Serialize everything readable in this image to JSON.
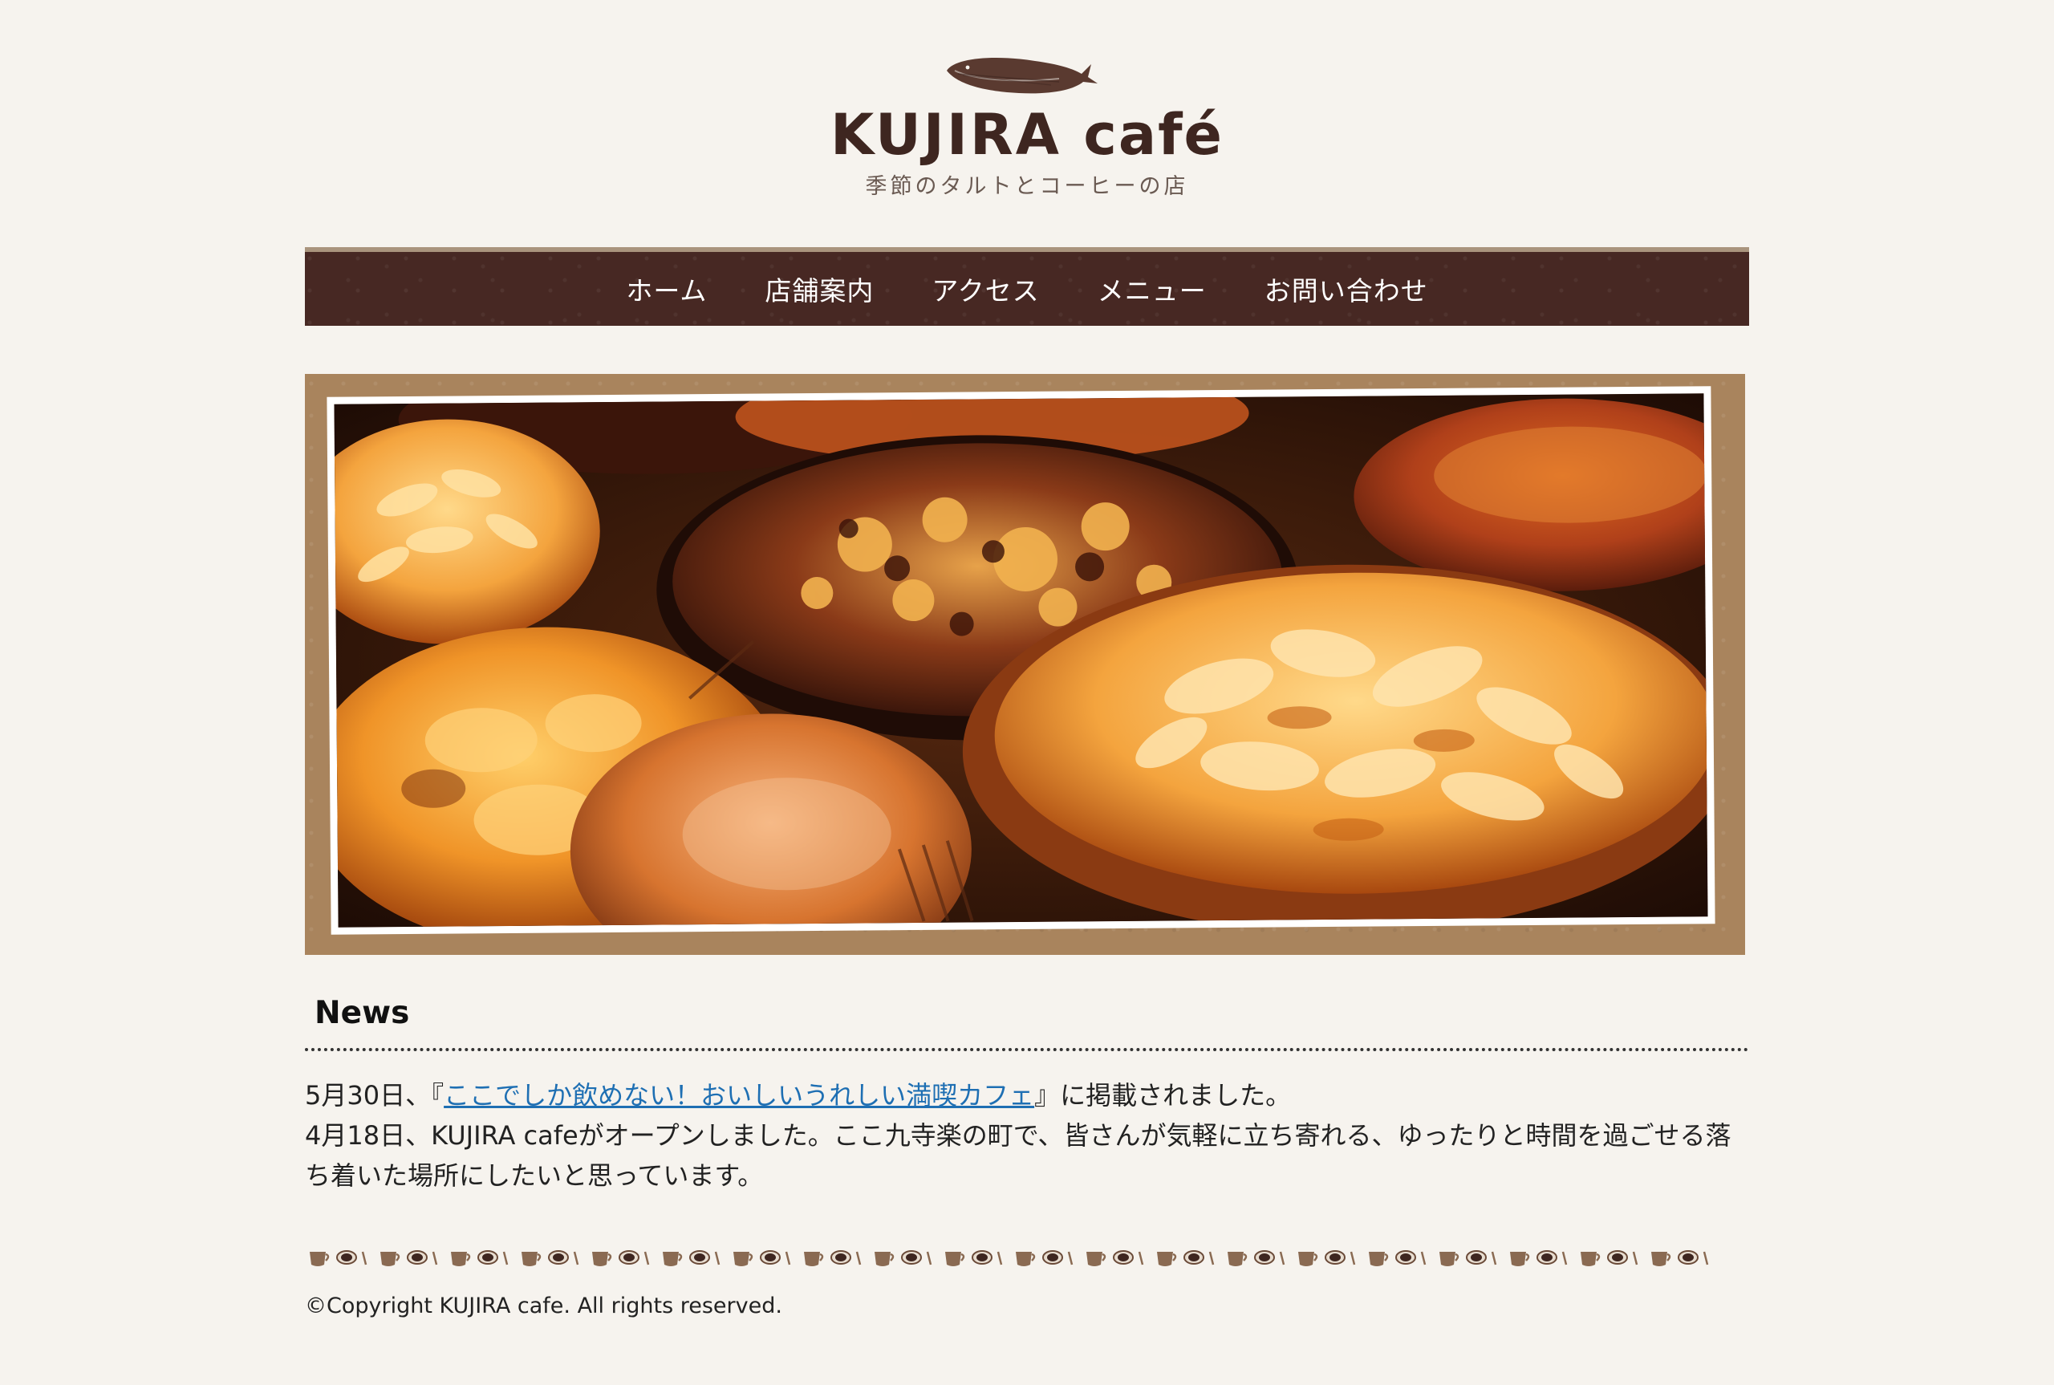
{
  "brand": {
    "logo_name": "KUJIRA",
    "logo_suffix": "café",
    "tagline": "季節のタルトとコーヒーの店"
  },
  "nav": {
    "items": [
      {
        "label": "ホーム"
      },
      {
        "label": "店舗案内"
      },
      {
        "label": "アクセス"
      },
      {
        "label": "メニュー"
      },
      {
        "label": "お問い合わせ"
      }
    ]
  },
  "news": {
    "title": "News",
    "item1_prefix": "5月30日、『",
    "item1_link": "ここでしか飲めない！おいしいうれしい満喫カフェ",
    "item1_suffix": "』に掲載されました。",
    "item2": "4月18日、KUJIRA cafeがオープンしました。ここ九寺楽の町で、皆さんが気軽に立ち寄れる、ゆったりと時間を過ごせる落ち着いた場所にしたいと思っています。"
  },
  "footer": {
    "copyright": "©Copyright KUJIRA cafe. All rights reserved."
  },
  "icons": {
    "logo_mark": "whale-icon",
    "divider": "coffee-cup-icon"
  },
  "colors": {
    "background": "#f6f3ee",
    "nav_bg": "#472823",
    "brand_text": "#3e2620",
    "frame": "#a9845d",
    "link": "#1e6fb3"
  }
}
